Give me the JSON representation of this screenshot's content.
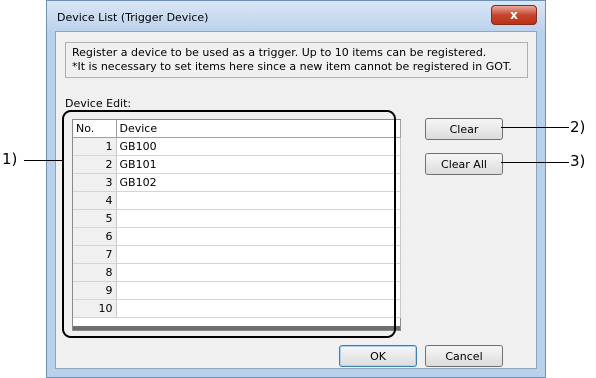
{
  "window": {
    "title": "Device List (Trigger Device)",
    "close_label": "x"
  },
  "description": {
    "line1": "Register a device to be used as a trigger. Up to 10 items can be registered.",
    "line2": "*It is necessary to set items here since a new item cannot be registered in GOT."
  },
  "device_edit": {
    "label": "Device Edit:",
    "columns": [
      "No.",
      "Device"
    ],
    "rows": [
      {
        "no": "1",
        "device": "GB100"
      },
      {
        "no": "2",
        "device": "GB101"
      },
      {
        "no": "3",
        "device": "GB102"
      },
      {
        "no": "4",
        "device": ""
      },
      {
        "no": "5",
        "device": ""
      },
      {
        "no": "6",
        "device": ""
      },
      {
        "no": "7",
        "device": ""
      },
      {
        "no": "8",
        "device": ""
      },
      {
        "no": "9",
        "device": ""
      },
      {
        "no": "10",
        "device": ""
      }
    ]
  },
  "buttons": {
    "clear": "Clear",
    "clear_all": "Clear All",
    "ok": "OK",
    "cancel": "Cancel"
  },
  "callouts": {
    "c1": "1)",
    "c2": "2)",
    "c3": "3)"
  }
}
